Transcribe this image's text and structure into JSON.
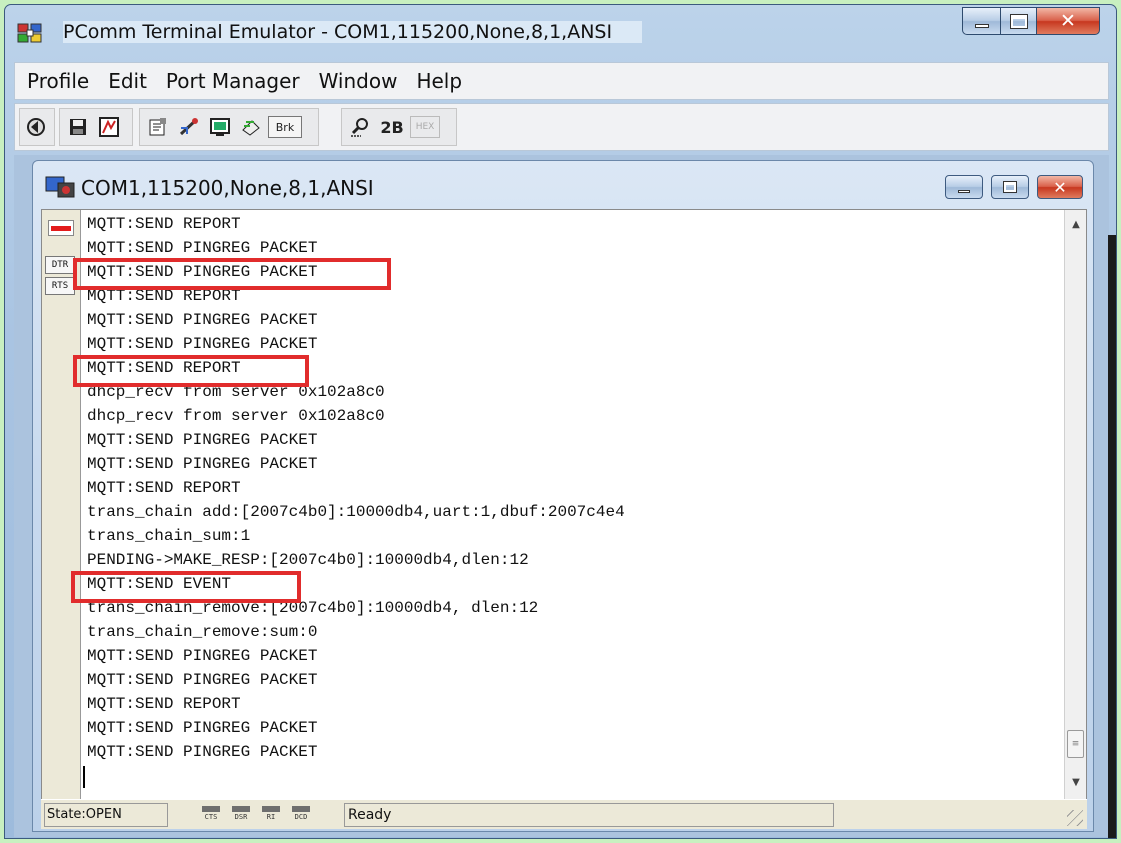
{
  "window": {
    "title": "PComm Terminal Emulator - COM1,115200,None,8,1,ANSI",
    "icon": "pcomm-app-icon"
  },
  "menu": [
    "Profile",
    "Edit",
    "Port Manager",
    "Window",
    "Help"
  ],
  "toolbar": {
    "break_label": "Brk",
    "two_byte_label": "2B",
    "hex_label": "HEX"
  },
  "child_window": {
    "title": "COM1,115200,None,8,1,ANSI",
    "icon": "terminal-session-icon"
  },
  "line_controls": {
    "dtr": "DTR",
    "rts": "RTS"
  },
  "terminal": {
    "lines": [
      "MQTT:SEND REPORT",
      "MQTT:SEND PINGREG PACKET",
      "MQTT:SEND PINGREG PACKET",
      "MQTT:SEND REPORT",
      "MQTT:SEND PINGREG PACKET",
      "MQTT:SEND PINGREG PACKET",
      "MQTT:SEND REPORT",
      "dhcp_recv from server 0x102a8c0",
      "dhcp_recv from server 0x102a8c0",
      "MQTT:SEND PINGREG PACKET",
      "MQTT:SEND PINGREG PACKET",
      "MQTT:SEND REPORT",
      "trans_chain add:[2007c4b0]:10000db4,uart:1,dbuf:2007c4e4",
      "trans_chain_sum:1",
      "PENDING->MAKE_RESP:[2007c4b0]:10000db4,dlen:12",
      "MQTT:SEND EVENT",
      "trans_chain_remove:[2007c4b0]:10000db4, dlen:12",
      "trans_chain_remove:sum:0",
      "MQTT:SEND PINGREG PACKET",
      "MQTT:SEND PINGREG PACKET",
      "MQTT:SEND REPORT",
      "MQTT:SEND PINGREG PACKET",
      "MQTT:SEND PINGREG PACKET"
    ]
  },
  "statusbar": {
    "state": "State:OPEN",
    "signals": [
      "CTS",
      "DSR",
      "RI",
      "DCD"
    ],
    "message": "Ready"
  },
  "colors": {
    "highlight_box": "#e12c2c",
    "connection_led": "#e31b1b"
  }
}
